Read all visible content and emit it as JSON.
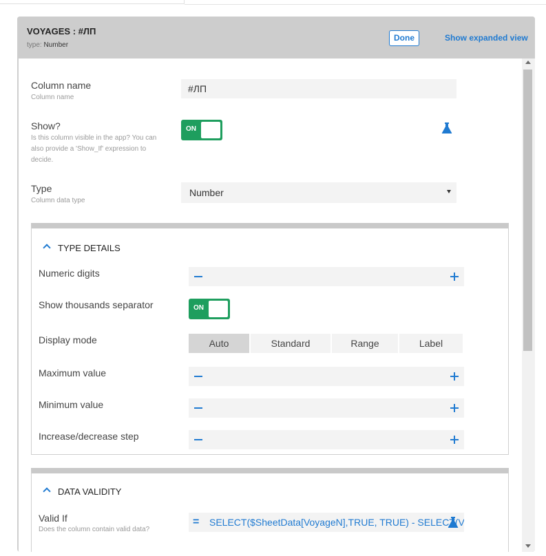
{
  "header": {
    "title": "VOYAGES : #ЛП",
    "type_prefix": "type:",
    "type_value": "Number",
    "done_label": "Done",
    "expand_label": "Show expanded view"
  },
  "column_name": {
    "label": "Column name",
    "sub": "Column name",
    "value": "#ЛП"
  },
  "show": {
    "label": "Show?",
    "sub": "Is this column visible in the app? You can also provide a 'Show_If' expression to decide.",
    "toggle": "ON"
  },
  "type": {
    "label": "Type",
    "sub": "Column data type",
    "value": "Number"
  },
  "type_details": {
    "title": "TYPE DETAILS",
    "numeric_digits": "Numeric digits",
    "thousands": {
      "label": "Show thousands separator",
      "toggle": "ON"
    },
    "display_mode": {
      "label": "Display mode",
      "options": [
        "Auto",
        "Standard",
        "Range",
        "Label"
      ],
      "selected": "Auto"
    },
    "max_value": "Maximum value",
    "min_value": "Minimum value",
    "step": "Increase/decrease step"
  },
  "data_validity": {
    "title": "DATA VALIDITY",
    "valid_if": {
      "label": "Valid If",
      "sub": "Does the column contain valid data?",
      "eq": "=",
      "expression": "SELECT($SheetData[VoyageN],TRUE, TRUE) - SELECT(V"
    }
  },
  "colors": {
    "accent": "#1f7ad1",
    "toggle_on": "#1e9e5e"
  }
}
